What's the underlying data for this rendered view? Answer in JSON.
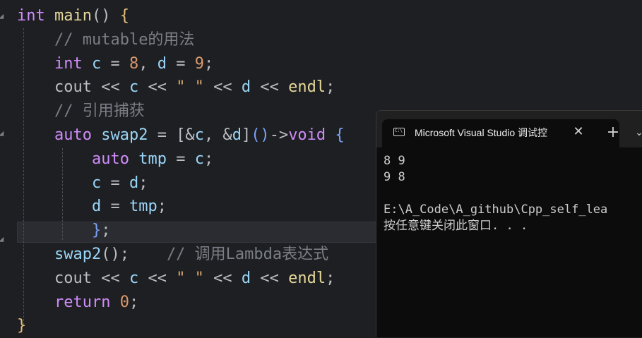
{
  "editor": {
    "lines": [
      [
        [
          "kw",
          "int"
        ],
        [
          "plain",
          " "
        ],
        [
          "fn",
          "main"
        ],
        [
          "plain",
          "() "
        ],
        [
          "br1",
          "{"
        ]
      ],
      [
        [
          "plain",
          "    "
        ],
        [
          "cmt",
          "// mutable的用法"
        ]
      ],
      [
        [
          "plain",
          "    "
        ],
        [
          "kw",
          "int"
        ],
        [
          "plain",
          " "
        ],
        [
          "id",
          "c"
        ],
        [
          "plain",
          " = "
        ],
        [
          "num",
          "8"
        ],
        [
          "plain",
          ", "
        ],
        [
          "id",
          "d"
        ],
        [
          "plain",
          " = "
        ],
        [
          "num",
          "9"
        ],
        [
          "plain",
          ";"
        ]
      ],
      [
        [
          "plain",
          "    "
        ],
        [
          "plain",
          "cout"
        ],
        [
          "plain",
          " << "
        ],
        [
          "id",
          "c"
        ],
        [
          "plain",
          " << "
        ],
        [
          "str",
          "\" \""
        ],
        [
          "plain",
          " << "
        ],
        [
          "id",
          "d"
        ],
        [
          "plain",
          " << "
        ],
        [
          "fn",
          "endl"
        ],
        [
          "plain",
          ";"
        ]
      ],
      [
        [
          "plain",
          "    "
        ],
        [
          "cmt",
          "// 引用捕获"
        ]
      ],
      [
        [
          "plain",
          "    "
        ],
        [
          "kw",
          "auto"
        ],
        [
          "plain",
          " "
        ],
        [
          "id",
          "swap2"
        ],
        [
          "plain",
          " = [&"
        ],
        [
          "id",
          "c"
        ],
        [
          "plain",
          ", &"
        ],
        [
          "id",
          "d"
        ],
        [
          "plain",
          "]"
        ],
        [
          "br2",
          "()"
        ],
        [
          "plain",
          "->"
        ],
        [
          "kw",
          "void"
        ],
        [
          "plain",
          " "
        ],
        [
          "br2",
          "{"
        ]
      ],
      [
        [
          "plain",
          "        "
        ],
        [
          "kw",
          "auto"
        ],
        [
          "plain",
          " "
        ],
        [
          "id",
          "tmp"
        ],
        [
          "plain",
          " = "
        ],
        [
          "id",
          "c"
        ],
        [
          "plain",
          ";"
        ]
      ],
      [
        [
          "plain",
          "        "
        ],
        [
          "id",
          "c"
        ],
        [
          "plain",
          " = "
        ],
        [
          "id",
          "d"
        ],
        [
          "plain",
          ";"
        ]
      ],
      [
        [
          "plain",
          "        "
        ],
        [
          "id",
          "d"
        ],
        [
          "plain",
          " = "
        ],
        [
          "id",
          "tmp"
        ],
        [
          "plain",
          ";"
        ]
      ],
      [
        [
          "plain",
          "        "
        ],
        [
          "br2",
          "}"
        ],
        [
          "plain",
          ";"
        ]
      ],
      [
        [
          "plain",
          "    "
        ],
        [
          "id",
          "swap2"
        ],
        [
          "plain",
          "();    "
        ],
        [
          "cmt",
          "// 调用Lambda表达式"
        ]
      ],
      [
        [
          "plain",
          "    "
        ],
        [
          "plain",
          "cout"
        ],
        [
          "plain",
          " << "
        ],
        [
          "id",
          "c"
        ],
        [
          "plain",
          " << "
        ],
        [
          "str",
          "\" \""
        ],
        [
          "plain",
          " << "
        ],
        [
          "id",
          "d"
        ],
        [
          "plain",
          " << "
        ],
        [
          "fn",
          "endl"
        ],
        [
          "plain",
          ";"
        ]
      ],
      [
        [
          "plain",
          "    "
        ],
        [
          "kw",
          "return"
        ],
        [
          "plain",
          " "
        ],
        [
          "num",
          "0"
        ],
        [
          "plain",
          ";"
        ]
      ],
      [
        [
          "br1",
          "}"
        ]
      ]
    ]
  },
  "terminal": {
    "tab_title": "Microsoft Visual Studio 调试控",
    "close_label": "✕",
    "new_tab_label": "+",
    "dropdown_label": "⌄",
    "output": [
      "8 9",
      "9 8",
      "",
      "E:\\A_Code\\A_github\\Cpp_self_lea",
      "按任意键关闭此窗口. . ."
    ]
  }
}
